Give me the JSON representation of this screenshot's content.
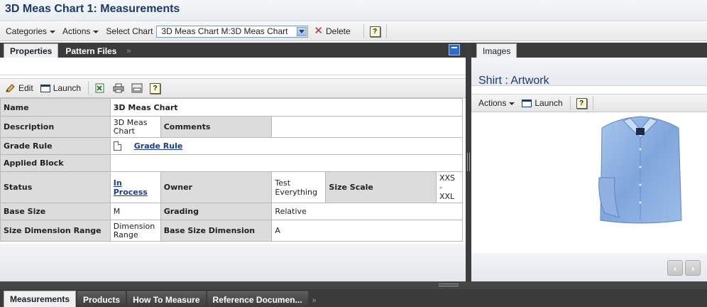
{
  "page": {
    "title": "3D Meas Chart 1: Measurements"
  },
  "toolbar": {
    "categories_label": "Categories",
    "actions_label": "Actions",
    "select_chart_label": "Select Chart",
    "select_chart_value": "3D Meas Chart M:3D Meas Chart",
    "delete_label": "Delete",
    "help_label": "?"
  },
  "left_tabs": [
    {
      "label": "Properties",
      "active": true
    },
    {
      "label": "Pattern Files",
      "active": false
    }
  ],
  "left_tabs_more": "»",
  "subtoolbar": {
    "edit_label": "Edit",
    "launch_label": "Launch",
    "help_label": "?"
  },
  "properties": {
    "name_label": "Name",
    "name_value": "3D Meas Chart",
    "description_label": "Description",
    "description_value": "3D Meas Chart",
    "comments_label": "Comments",
    "comments_value": "",
    "grade_rule_label": "Grade Rule",
    "grade_rule_value": "Grade Rule",
    "applied_block_label": "Applied Block",
    "applied_block_value": "",
    "status_label": "Status",
    "status_value": "In Process",
    "owner_label": "Owner",
    "owner_value": "Test Everything",
    "size_scale_label": "Size Scale",
    "size_scale_value": "XXS - XXL",
    "base_size_label": "Base Size",
    "base_size_value": "M",
    "grading_label": "Grading",
    "grading_value": "Relative",
    "size_dim_range_label": "Size Dimension Range",
    "size_dim_range_value": "Dimension Range",
    "base_size_dim_label": "Base Size Dimension",
    "base_size_dim_value": "A"
  },
  "right_tabs": [
    {
      "label": "Images",
      "active": true
    }
  ],
  "right_panel": {
    "title": "Shirt : Artwork",
    "actions_label": "Actions",
    "launch_label": "Launch",
    "help_label": "?",
    "prev_label": "‹",
    "next_label": "›"
  },
  "bottom_tabs": [
    {
      "label": "Measurements",
      "active": true
    },
    {
      "label": "Products",
      "active": false
    },
    {
      "label": "How To Measure",
      "active": false
    },
    {
      "label": "Reference Documen...",
      "active": false
    }
  ],
  "bottom_tabs_more": "»",
  "colors": {
    "title": "#1c3b6a",
    "link": "#1a3d8f",
    "dark_bar": "#3b3b3b",
    "label_cell": "#dcdcdc"
  }
}
